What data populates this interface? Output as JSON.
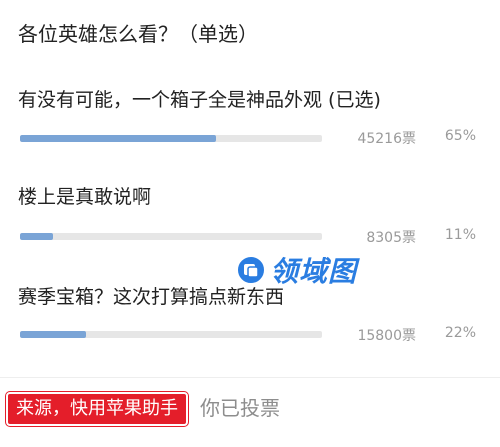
{
  "poll": {
    "title": "各位英雄怎么看？（单选）",
    "options": [
      {
        "label": "有没有可能，一个箱子全是神品外观 (已选)",
        "votes": "45216票",
        "percent": "65%",
        "share": 0.65
      },
      {
        "label": "楼上是真敢说啊",
        "votes": "8305票",
        "percent": "11%",
        "share": 0.11
      },
      {
        "label": "赛季宝箱？这次打算搞点新东西",
        "votes": "15800票",
        "percent": "22%",
        "share": 0.22
      }
    ]
  },
  "footer": {
    "status": "你已投票"
  },
  "overlay": {
    "source_badge": "来源，快用苹果助手",
    "watermark_text": "领域图",
    "watermark_icon": "app-logo-icon"
  },
  "colors": {
    "bar_fill": "#7aa4d6",
    "bar_track": "#e6e6e6",
    "badge_bg": "#e41e2a",
    "watermark": "#2a7de1"
  }
}
